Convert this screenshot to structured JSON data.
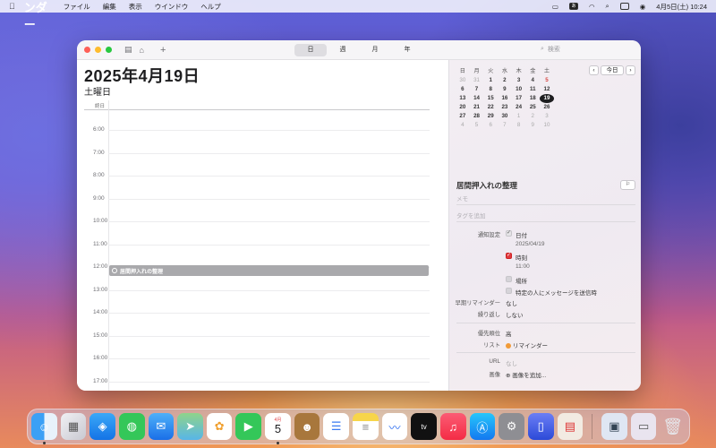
{
  "menubar": {
    "app_name": "カレンダー",
    "menus": [
      "ファイル",
      "編集",
      "表示",
      "ウインドウ",
      "ヘルプ"
    ],
    "input_badge": "あ",
    "datetime": "4月5日(土)  10:24"
  },
  "toolbar": {
    "views": [
      "日",
      "週",
      "月",
      "年"
    ],
    "active_view": "日",
    "search_placeholder": "検索",
    "add_label": "+"
  },
  "day": {
    "title": "2025年4月19日",
    "weekday": "土曜日",
    "allday_label": "終日",
    "hours": [
      "6:00",
      "7:00",
      "8:00",
      "9:00",
      "10:00",
      "11:00",
      "12:00",
      "13:00",
      "14:00",
      "15:00",
      "16:00",
      "17:00"
    ],
    "event": {
      "title": "居間押入れの整理",
      "start": "11:00"
    }
  },
  "mini_calendar": {
    "weekdays": [
      "日",
      "月",
      "火",
      "水",
      "木",
      "金",
      "土"
    ],
    "weeks": [
      [
        "30",
        "31",
        "1",
        "2",
        "3",
        "4",
        "5"
      ],
      [
        "6",
        "7",
        "8",
        "9",
        "10",
        "11",
        "12"
      ],
      [
        "13",
        "14",
        "15",
        "16",
        "17",
        "18",
        "19"
      ],
      [
        "20",
        "21",
        "22",
        "23",
        "24",
        "25",
        "26"
      ],
      [
        "27",
        "28",
        "29",
        "30",
        "1",
        "2",
        "3"
      ],
      [
        "4",
        "5",
        "6",
        "7",
        "8",
        "9",
        "10"
      ]
    ],
    "selected": "19",
    "today_label": "今日",
    "prev": "‹",
    "next": "›"
  },
  "reminder": {
    "title": "居間押入れの整理",
    "memo_placeholder": "メモ",
    "tags_placeholder": "タグを追加",
    "notify_label": "通知設定",
    "date_label": "日付",
    "date_value": "2025/04/19",
    "time_label": "時刻",
    "time_value": "11:00",
    "location_label": "場所",
    "message_label": "特定の人にメッセージを送信時",
    "early_label": "早期リマインダー",
    "early_value": "なし",
    "repeat_label": "繰り返し",
    "repeat_value": "しない",
    "priority_label": "優先順位",
    "priority_value": "高",
    "list_label": "リスト",
    "list_value": "リマインダー",
    "url_label": "URL",
    "url_value": "なし",
    "image_label": "画像",
    "image_value": "画像を追加..."
  },
  "dock": {
    "calendar_month": "4月",
    "calendar_day": "5",
    "tv_label": "tv"
  },
  "colors": {
    "event_gray": "#a9a9ac",
    "priority_red": "#e0393e",
    "list_orange": "#f19a38"
  }
}
